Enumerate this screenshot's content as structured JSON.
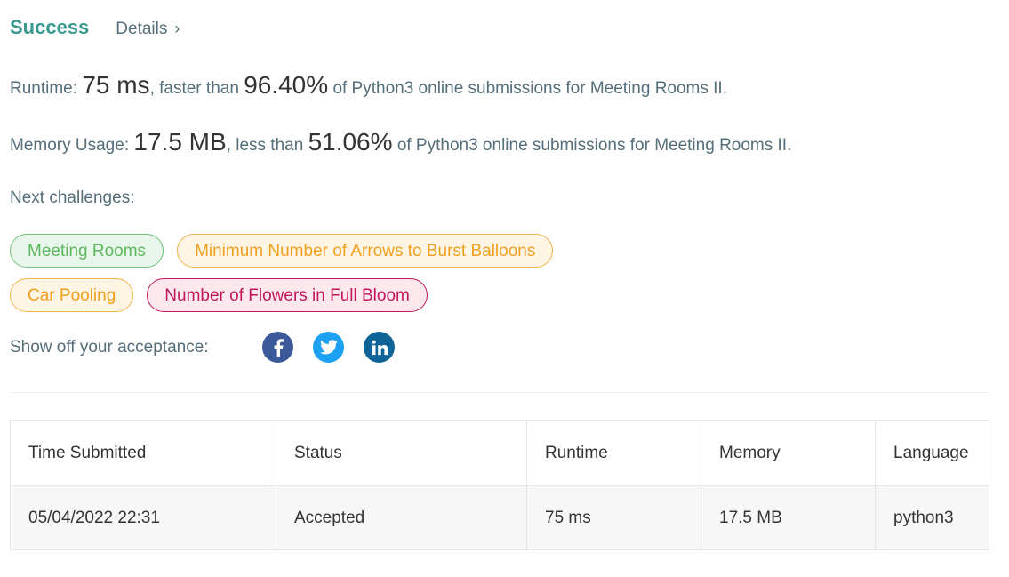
{
  "header": {
    "status": "Success",
    "details_label": "Details",
    "details_chevron": "›"
  },
  "runtime": {
    "label": "Runtime:",
    "value": "75 ms",
    "mid": ", faster than",
    "percent": "96.40%",
    "suffix": "of Python3 online submissions for Meeting Rooms II."
  },
  "memory": {
    "label": "Memory Usage:",
    "value": "17.5 MB",
    "mid": ", less than",
    "percent": "51.06%",
    "suffix": "of Python3 online submissions for Meeting Rooms II."
  },
  "next_challenges": {
    "label": "Next challenges:",
    "items": [
      {
        "label": "Meeting Rooms",
        "difficulty": "easy"
      },
      {
        "label": "Minimum Number of Arrows to Burst Balloons",
        "difficulty": "medium"
      },
      {
        "label": "Car Pooling",
        "difficulty": "medium"
      },
      {
        "label": "Number of Flowers in Full Bloom",
        "difficulty": "hard"
      }
    ]
  },
  "share": {
    "label": "Show off your acceptance:",
    "icons": [
      "facebook-icon",
      "twitter-icon",
      "linkedin-icon"
    ],
    "colors": {
      "facebook": "#3b5998",
      "twitter": "#1da1f2",
      "linkedin": "#0e6496"
    }
  },
  "table": {
    "headers": [
      "Time Submitted",
      "Status",
      "Runtime",
      "Memory",
      "Language"
    ],
    "rows": [
      [
        "05/04/2022 22:31",
        "Accepted",
        "75 ms",
        "17.5 MB",
        "python3"
      ]
    ]
  },
  "colors": {
    "success": "#3a9a8e",
    "accepted": "#2e8a7a"
  }
}
